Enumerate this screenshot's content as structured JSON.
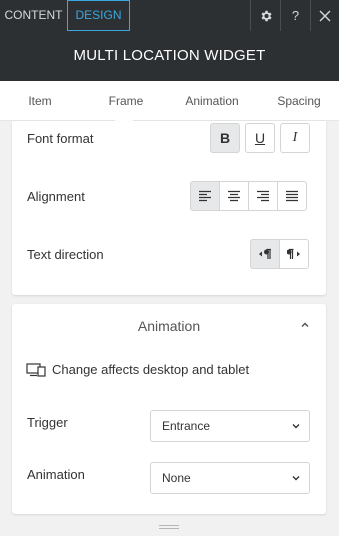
{
  "topbar": {
    "tab_content": "CONTENT",
    "tab_design": "DESIGN",
    "help_label": "?",
    "icons": [
      "gear-icon",
      "help-icon",
      "close-icon"
    ]
  },
  "header": {
    "title": "MULTI LOCATION WIDGET"
  },
  "subtabs": [
    "Item",
    "Frame",
    "Animation",
    "Spacing"
  ],
  "frame_card": {
    "font_format_label": "Font format",
    "font_format_buttons": [
      "B",
      "U",
      "I"
    ],
    "alignment_label": "Alignment",
    "text_direction_label": "Text direction"
  },
  "animation_card": {
    "title": "Animation",
    "info_text": "Change affects desktop and tablet",
    "trigger_label": "Trigger",
    "trigger_value": "Entrance",
    "animation_label": "Animation",
    "animation_value": "None"
  },
  "colors": {
    "accent": "#3aa8df",
    "dark": "#2d3033",
    "background": "#f1f1f1"
  }
}
